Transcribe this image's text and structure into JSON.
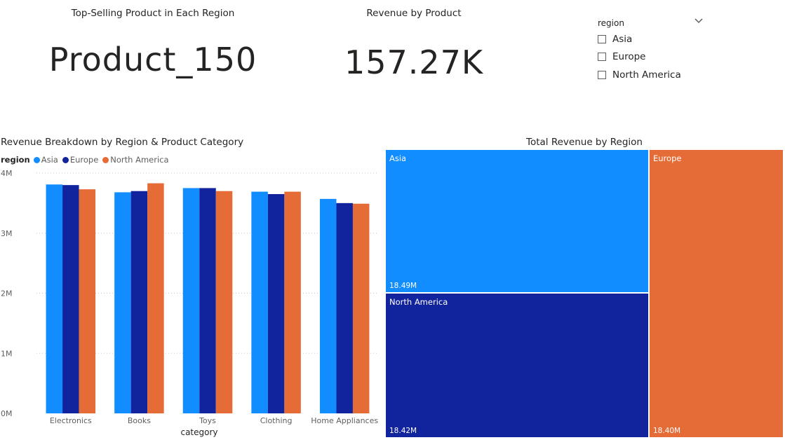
{
  "cards": {
    "top_product": {
      "title": "Top-Selling Product in Each Region",
      "value": "Product_150"
    },
    "revenue": {
      "title": "Revenue by Product",
      "value": "157.27K"
    }
  },
  "slicer": {
    "header": "region",
    "options": [
      "Asia",
      "Europe",
      "North America"
    ],
    "chevron_icon": "chevron-down-icon"
  },
  "colors": {
    "Asia": "#118DFF",
    "Europe": "#12239E",
    "North America": "#E66C37"
  },
  "chart_data": [
    {
      "type": "bar",
      "title": "Revenue Breakdown by Region & Product Category",
      "xlabel": "category",
      "ylabel": "",
      "legend_title": "region",
      "legend_position": "top-left",
      "categories": [
        "Electronics",
        "Books",
        "Toys",
        "Clothing",
        "Home Appliances"
      ],
      "series": [
        {
          "name": "Asia",
          "values": [
            3.81,
            3.68,
            3.75,
            3.69,
            3.57
          ]
        },
        {
          "name": "Europe",
          "values": [
            3.8,
            3.7,
            3.75,
            3.65,
            3.5
          ]
        },
        {
          "name": "North America",
          "values": [
            3.73,
            3.83,
            3.7,
            3.69,
            3.49
          ]
        }
      ],
      "yunit": "M",
      "ylim": [
        0,
        4
      ],
      "yticks": [
        "0M",
        "1M",
        "2M",
        "3M",
        "4M"
      ],
      "grid": true
    },
    {
      "type": "treemap",
      "title": "Total Revenue by Region",
      "items": [
        {
          "name": "Asia",
          "value": 18.49,
          "label": "18.49M"
        },
        {
          "name": "North America",
          "value": 18.42,
          "label": "18.42M"
        },
        {
          "name": "Europe",
          "value": 18.4,
          "label": "18.40M"
        }
      ]
    }
  ]
}
